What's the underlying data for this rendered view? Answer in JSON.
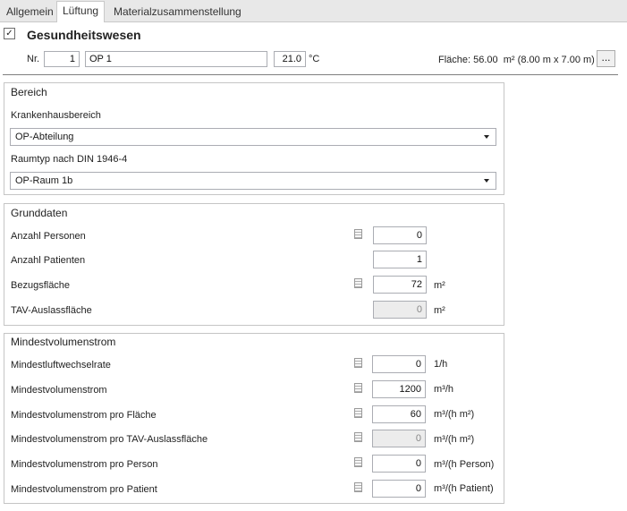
{
  "tabs": [
    {
      "label": "Allgemein"
    },
    {
      "label": "Lüftung"
    },
    {
      "label": "Materialzusammenstellung"
    }
  ],
  "header": {
    "checkbox_mark": "✓",
    "title": "Gesundheitswesen",
    "nr_label": "Nr.",
    "nr_value": "1",
    "name_value": "OP 1",
    "temperature_value": "21.0",
    "temperature_unit": "°C",
    "area_text": "Fläche: 56.00  m² (8.00 m x 7.00 m)",
    "more_button": "..."
  },
  "bereich": {
    "title": "Bereich",
    "krankenhaus_label": "Krankenhausbereich",
    "krankenhaus_value": "OP-Abteilung",
    "raumtyp_label": "Raumtyp nach DIN 1946-4",
    "raumtyp_value": "OP-Raum 1b"
  },
  "grunddaten": {
    "title": "Grunddaten",
    "rows": [
      {
        "label": "Anzahl Personen",
        "value": "0",
        "unit": ""
      },
      {
        "label": "Anzahl Patienten",
        "value": "1",
        "unit": ""
      },
      {
        "label": "Bezugsfläche",
        "value": "72",
        "unit": "m²"
      },
      {
        "label": "TAV-Auslassfläche",
        "value": "0",
        "unit": "m²"
      }
    ]
  },
  "mindest": {
    "title": "Mindestvolumenstrom",
    "rows": [
      {
        "label": "Mindestluftwechselrate",
        "value": "0",
        "unit": "1/h"
      },
      {
        "label": "Mindestvolumenstrom",
        "value": "1200",
        "unit": "m³/h"
      },
      {
        "label": "Mindestvolumenstrom pro Fläche",
        "value": "60",
        "unit": "m³/(h m²)"
      },
      {
        "label": "Mindestvolumenstrom pro TAV-Auslassfläche",
        "value": "0",
        "unit": "m³/(h m²)"
      },
      {
        "label": "Mindestvolumenstrom pro Person",
        "value": "0",
        "unit": "m³/(h Person)"
      },
      {
        "label": "Mindestvolumenstrom pro Patient",
        "value": "0",
        "unit": "m³/(h Patient)"
      }
    ]
  }
}
